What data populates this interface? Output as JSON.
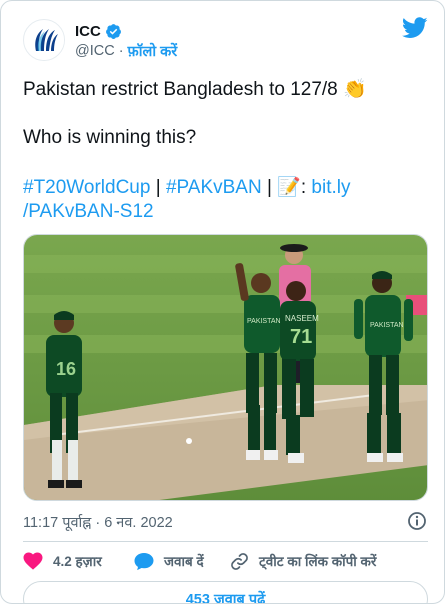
{
  "account": {
    "name": "ICC",
    "handle": "@ICC",
    "separator": "·",
    "follow_label": "फ़ॉलो करें"
  },
  "tweet": {
    "line1": "Pakistan restrict Bangladesh to 127/8",
    "clap_emoji": "👏",
    "line2": "Who is winning this?",
    "hashtag1": "#T20WorldCup",
    "pipe1": " | ",
    "hashtag2": "#PAKvBAN",
    "pipe2": " | ",
    "memo_emoji": "📝",
    "colon": ": ",
    "link_part1": "bit.ly",
    "link_part2": "/PAKvBAN-S12"
  },
  "timestamp": "11:17 पूर्वाह्न · 6 नव. 2022",
  "actions": {
    "likes": "4.2 हज़ार",
    "reply": "जवाब दें",
    "copy_link": "ट्वीट का लिंक कॉपी करें"
  },
  "replies_button": "453 जवाब पढ़ें",
  "colors": {
    "accent": "#1d9bf0",
    "like": "#f91880",
    "text_secondary": "#536471",
    "border": "#cfd9de"
  },
  "icons": [
    "icc-logo-icon",
    "verified-badge-icon",
    "twitter-bird-icon",
    "info-icon",
    "heart-icon",
    "reply-bubble-icon",
    "link-icon"
  ]
}
